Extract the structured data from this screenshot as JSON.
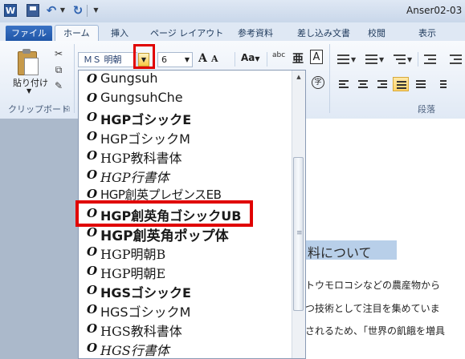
{
  "window": {
    "app_icon": "W",
    "document_title": "Anser02-03"
  },
  "quick_access": {
    "icons": [
      "word-icon",
      "save-icon",
      "undo-icon",
      "redo-icon",
      "customize-toolbar-dropdown-icon"
    ]
  },
  "tabs": {
    "file": "ファイル",
    "items": [
      "ホーム",
      "挿入",
      "ページ レイアウト",
      "参考資料",
      "差し込み文書",
      "校閲",
      "表示"
    ],
    "active": "ホーム"
  },
  "ribbon": {
    "clipboard": {
      "paste_label": "貼り付け",
      "group_label": "クリップボード"
    },
    "font": {
      "name_value": "ＭＳ 明朝",
      "size_value": "6",
      "grow_label": "A",
      "shrink_label": "A",
      "case_label": "Aa",
      "abc_label": "abc",
      "phonetic_label": "亜",
      "border_label": "A",
      "enclose_label": "字"
    },
    "paragraph": {
      "group_label": "段落"
    }
  },
  "font_list": {
    "items": [
      "Gungsuh",
      "GungsuhChe",
      "HGPゴシックE",
      "HGPゴシックM",
      "HGP教科書体",
      "HGP行書体",
      "HGP創英プレゼンスEB",
      "HGP創英角ゴシックUB",
      "HGP創英角ポップ体",
      "HGP明朝B",
      "HGP明朝E",
      "HGSゴシックE",
      "HGSゴシックM",
      "HGS教科書体",
      "HGS行書体"
    ],
    "highlighted": "HGP創英角ゴシックUB",
    "item_icon": "O"
  },
  "document": {
    "heading": "料について",
    "lines": [
      "トウモロコシなどの農産物から",
      "つ技術として注目を集めていま",
      "されるため、「世界の飢餓を増具"
    ]
  },
  "colors": {
    "highlight_box": "#e00000",
    "file_tab": "#2b62b5",
    "selection": "#b8cfe9"
  }
}
